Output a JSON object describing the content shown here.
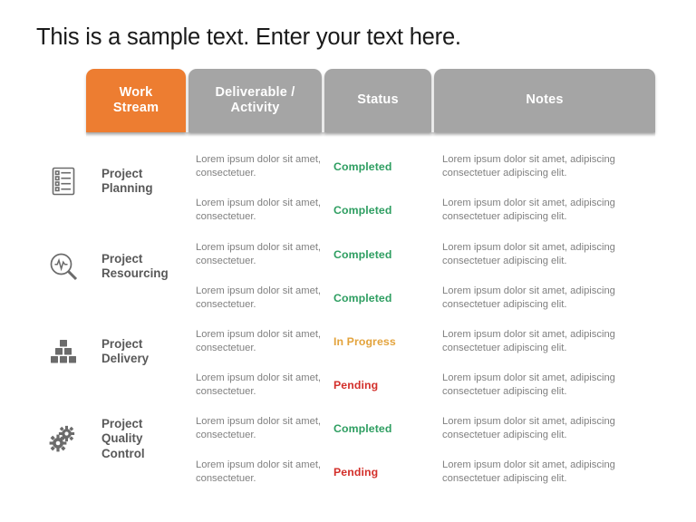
{
  "page": {
    "title": "This is a sample text. Enter your text here."
  },
  "table": {
    "headers": [
      {
        "label_line1": "Work",
        "label_line2": "Stream",
        "color": "#ED7D31"
      },
      {
        "label_line1": "Deliverable /",
        "label_line2": "Activity",
        "color": "#A5A5A5"
      },
      {
        "label_line1": "Status",
        "label_line2": "",
        "color": "#A5A5A5"
      },
      {
        "label_line1": "Notes",
        "label_line2": "",
        "color": "#A5A5A5"
      }
    ],
    "workstreams": [
      {
        "icon": "checklist-icon",
        "label_line1": "Project",
        "label_line2": "Planning",
        "label_line3": ""
      },
      {
        "icon": "magnifier-pulse-icon",
        "label_line1": "Project",
        "label_line2": "Resourcing",
        "label_line3": ""
      },
      {
        "icon": "blocks-stack-icon",
        "label_line1": "Project",
        "label_line2": "Delivery",
        "label_line3": ""
      },
      {
        "icon": "gears-icon",
        "label_line1": "Project",
        "label_line2": "Quality",
        "label_line3": "Control"
      }
    ],
    "rows": [
      {
        "deliverable": "Lorem ipsum dolor sit amet, consectetuer.",
        "status": "Completed",
        "status_kind": "completed",
        "notes": "Lorem ipsum dolor sit amet, adipiscing consectetuer adipiscing elit."
      },
      {
        "deliverable": "Lorem ipsum dolor sit amet, consectetuer.",
        "status": "Completed",
        "status_kind": "completed",
        "notes": "Lorem ipsum dolor sit amet, adipiscing consectetuer adipiscing elit."
      },
      {
        "deliverable": "Lorem ipsum dolor sit amet, consectetuer.",
        "status": "Completed",
        "status_kind": "completed",
        "notes": "Lorem ipsum dolor sit amet, adipiscing consectetuer adipiscing elit."
      },
      {
        "deliverable": "Lorem ipsum dolor sit amet, consectetuer.",
        "status": "Completed",
        "status_kind": "completed",
        "notes": "Lorem ipsum dolor sit amet, adipiscing consectetuer adipiscing elit."
      },
      {
        "deliverable": "Lorem ipsum dolor sit amet, consectetuer.",
        "status": "In Progress",
        "status_kind": "inprogress",
        "notes": "Lorem ipsum dolor sit amet, adipiscing consectetuer adipiscing elit."
      },
      {
        "deliverable": "Lorem ipsum dolor sit amet, consectetuer.",
        "status": "Pending",
        "status_kind": "pending",
        "notes": "Lorem ipsum dolor sit amet, adipiscing consectetuer adipiscing elit."
      },
      {
        "deliverable": "Lorem ipsum dolor sit amet, consectetuer.",
        "status": "Completed",
        "status_kind": "completed",
        "notes": "Lorem ipsum dolor sit amet, adipiscing consectetuer adipiscing elit."
      },
      {
        "deliverable": "Lorem ipsum dolor sit amet, consectetuer.",
        "status": "Pending",
        "status_kind": "pending",
        "notes": "Lorem ipsum dolor sit amet, adipiscing consectetuer adipiscing elit."
      }
    ]
  },
  "colors": {
    "accent_orange": "#ED7D31",
    "header_gray": "#A5A5A5",
    "status_completed": "#2E9E61",
    "status_inprogress": "#E3A33C",
    "status_pending": "#D32F2A",
    "body_text": "#808080",
    "label_text": "#595959"
  }
}
